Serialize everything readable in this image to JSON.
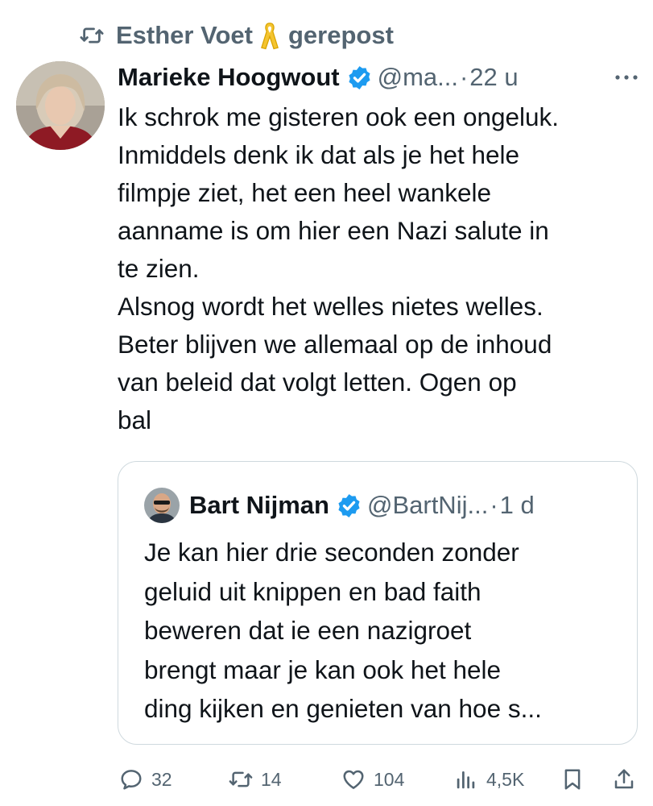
{
  "social_context": {
    "reposter_name": "Esther Voet",
    "label": "gerepost",
    "ribbon_icon": "yellow-ribbon-icon"
  },
  "tweet": {
    "author_name": "Marieke Hoogwout",
    "handle": "@ma...",
    "separator": "·",
    "time": "22 u",
    "text": "Ik schrok me gisteren ook een ongeluk.\nInmiddels denk ik dat als je het hele\nfilmpje ziet, het een heel wankele\naanname is om hier een Nazi salute in\nte zien.\nAlsnog wordt het welles nietes welles.\nBeter blijven we allemaal op de inhoud\nvan beleid dat volgt letten. Ogen op\nbal"
  },
  "quote": {
    "author_name": "Bart Nijman",
    "handle": "@BartNij...",
    "separator": "·",
    "time": "1 d",
    "text": "Je kan hier drie seconden zonder\ngeluid uit knippen en bad faith\nbeweren dat ie een nazigroet\nbrengt maar je kan ook het hele\nding kijken en genieten van hoe s..."
  },
  "actions": {
    "replies": "32",
    "reposts": "14",
    "likes": "104",
    "views": "4,5K"
  },
  "colors": {
    "text": "#0f1419",
    "secondary": "#536471",
    "verified": "#1d9bf0",
    "border": "#cfd9de",
    "ribbon": "#f4c430"
  }
}
